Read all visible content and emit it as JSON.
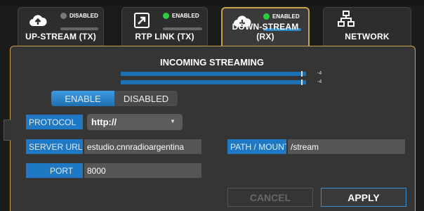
{
  "tabs": [
    {
      "label": "UP-STREAM (TX)",
      "status": "DISABLED",
      "status_color": "#7a7a7a",
      "icon": "cloud-upload-icon",
      "active": false
    },
    {
      "label": "RTP LINK (TX)",
      "status": "ENABLED",
      "status_color": "#2ecc40",
      "icon": "external-link-icon",
      "active": false
    },
    {
      "label": "DOWN-STREAM (RX)",
      "status": "ENABLED",
      "status_color": "#2ecc40",
      "icon": "cloud-download-icon",
      "active": true
    },
    {
      "label": "NETWORK",
      "icon": "network-icon",
      "active": false
    }
  ],
  "panel": {
    "title": "INCOMING STREAMING",
    "meters": [
      {
        "label": "-4"
      },
      {
        "label": "-4"
      }
    ],
    "toggle": {
      "enable_label": "ENABLE",
      "disabled_label": "DISABLED"
    },
    "protocol": {
      "label": "PROTOCOL",
      "value": "http://"
    },
    "server_url": {
      "label": "SERVER URL",
      "value": "estudio.cnnradioargentina"
    },
    "path": {
      "label": "PATH / MOUNT",
      "value": "/stream"
    },
    "port": {
      "label": "PORT",
      "value": "8000"
    },
    "cancel_label": "CANCEL",
    "apply_label": "APPLY"
  },
  "colors": {
    "accent": "#1e78c4",
    "active_border": "#c9a24a"
  }
}
